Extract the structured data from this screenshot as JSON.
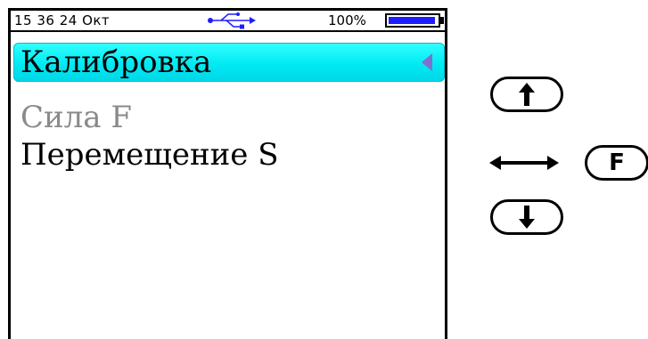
{
  "status_bar": {
    "time_date": "15 36 24 Окт",
    "battery_percent_text": "100%",
    "battery_level": 0.97,
    "battery_color": "#1d1dff",
    "usb_icon": "usb-icon"
  },
  "menu": {
    "items": [
      {
        "label": "Калибровка",
        "selected": true
      },
      {
        "label": "Сила F",
        "selected": false
      },
      {
        "label": "Перемещение S",
        "selected": false
      }
    ],
    "highlight_color": "#00eaf3",
    "disabled_color": "#8a8a8a"
  },
  "keys": {
    "up": {
      "icon": "arrow-up-icon"
    },
    "down": {
      "icon": "arrow-down-icon"
    },
    "left_right": {
      "icon": "left-right-arrow-icon"
    },
    "f": {
      "label": "F"
    }
  }
}
